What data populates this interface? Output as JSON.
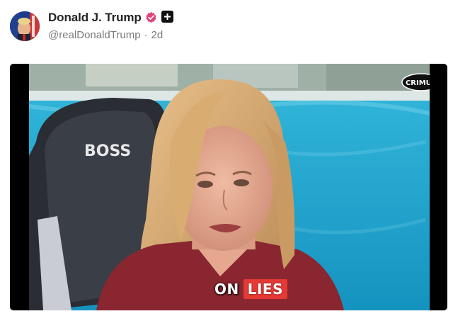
{
  "post": {
    "author_name": "Donald J. Trump",
    "handle": "@realDonaldTrump",
    "separator": "·",
    "time_ago": "2d",
    "verified_icon": "verified-badge-icon",
    "platform_icon": "truth-social-icon"
  },
  "video": {
    "chair_brand_text": "BOSS",
    "channel_logo_text": "CRIMUS",
    "caption_words": [
      "ON",
      "LIES"
    ],
    "highlight_color": "#e53935"
  },
  "colors": {
    "author_text": "#222222",
    "meta_text": "#7a7a7a",
    "verified_badge": "#e0447c",
    "pool_blue": "#1ba8cf"
  }
}
